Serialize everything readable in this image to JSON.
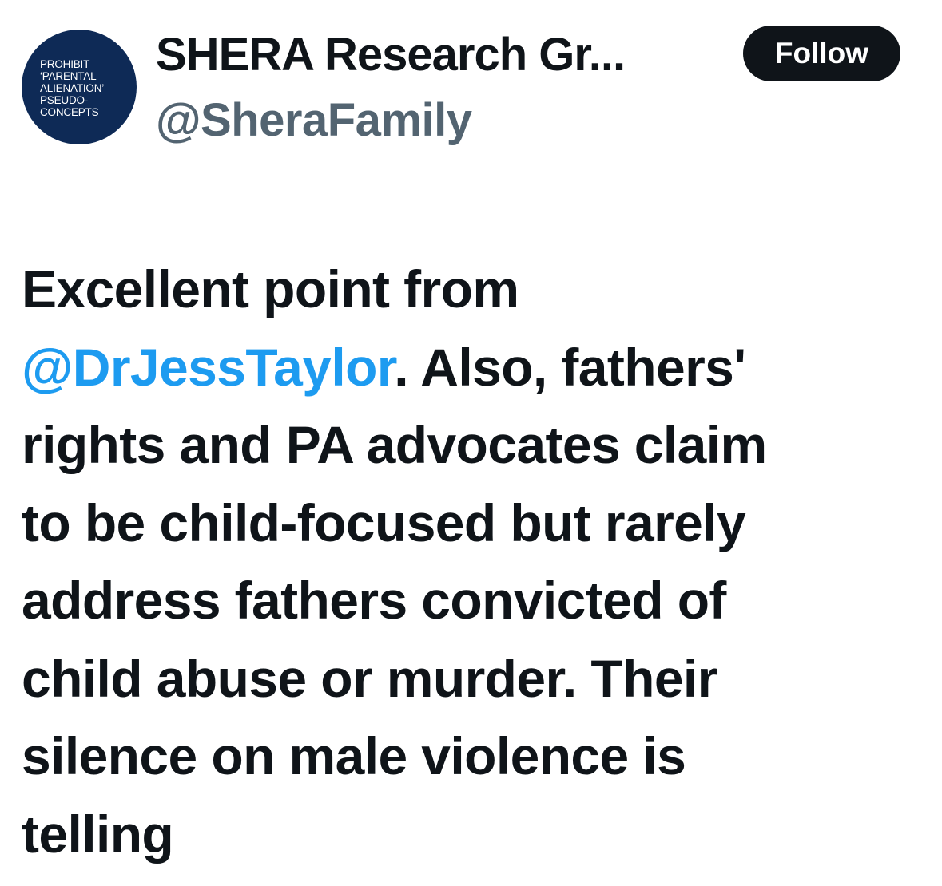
{
  "author": {
    "avatar_text": [
      "PROHIBIT",
      "‘PARENTAL",
      "ALIENATION’",
      "PSEUDO-",
      "CONCEPTS"
    ],
    "display_name": "SHERA Research Gr...",
    "handle": "@SheraFamily",
    "avatar_color": "#0e2a56"
  },
  "follow_button": {
    "label": "Follow"
  },
  "tweet": {
    "line1": "Excellent point from",
    "mention": "@DrJessTaylor",
    "line2_rest": ". Also, fathers'",
    "line3": "rights and PA advocates claim",
    "line4": "to be child-focused but rarely",
    "line5": "address fathers convicted of",
    "line6": "child abuse or murder. Their",
    "line7": "silence on male violence is",
    "line8": "telling"
  },
  "colors": {
    "text": "#0f1419",
    "secondary": "#536471",
    "link": "#1d9bf0",
    "button_bg": "#0f1419"
  }
}
